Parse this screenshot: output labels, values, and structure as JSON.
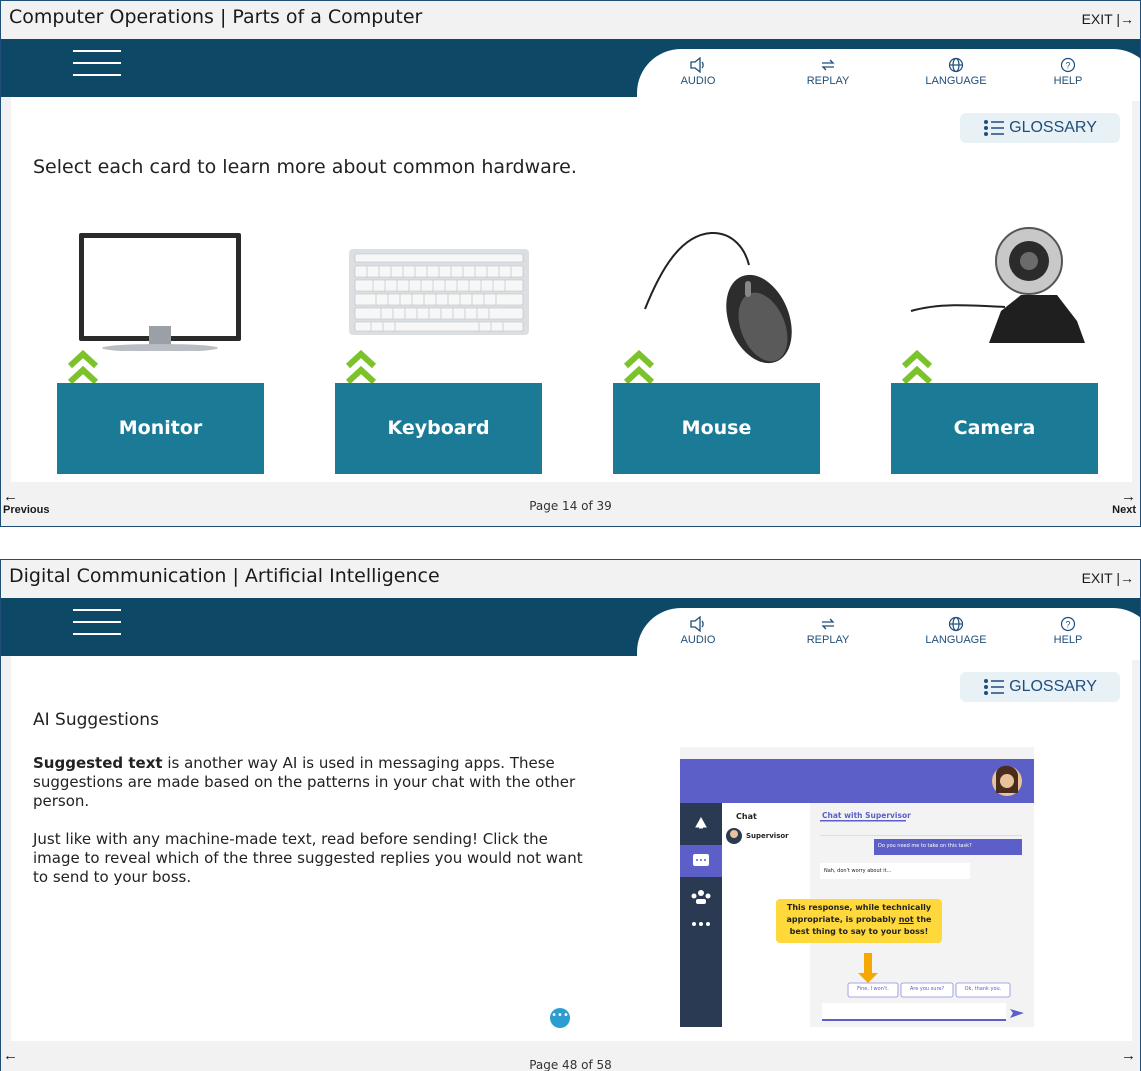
{
  "colors": {
    "navbar": "#0d4867",
    "card": "#1b7b97",
    "chevron": "#7cc22b",
    "accent": "#1f4e79"
  },
  "toolbar": {
    "audio": "AUDIO",
    "replay": "REPLAY",
    "language": "LANGUAGE",
    "help": "HELP",
    "glossary": "GLOSSARY"
  },
  "panel1": {
    "title": "Computer Operations | Parts of a Computer",
    "exit": "EXIT",
    "instruction": "Select each card to learn more about common hardware.",
    "cards": [
      {
        "label": "Monitor",
        "icon": "monitor-image"
      },
      {
        "label": "Keyboard",
        "icon": "keyboard-image"
      },
      {
        "label": "Mouse",
        "icon": "mouse-image"
      },
      {
        "label": "Camera",
        "icon": "webcam-image"
      }
    ],
    "previous": "Previous",
    "next": "Next",
    "page": "Page 14 of 39"
  },
  "panel2": {
    "title": "Digital Communication | Artificial Intelligence",
    "exit": "EXIT",
    "heading": "AI Suggestions",
    "para1_bold": "Suggested text",
    "para1_rest": " is another way AI is used in messaging apps. These suggestions are made based on the patterns in your chat with the other person.",
    "para2": "Just like with any machine-made text, read before sending! Click the image to reveal which of the three suggested replies you would not want to send to your boss.",
    "page": "Page 48 of 58",
    "chat_image": {
      "sidebar_title": "Chat",
      "contact": "Supervisor",
      "tab": "Chat with Supervisor",
      "incoming": "Do you need me to take on this task?",
      "outgoing": "Nah, don't worry about it...",
      "callout_line1": "This response, while technically",
      "callout_line2_a": "appropriate, is probably ",
      "callout_line2_b": "not",
      "callout_line2_c": " the",
      "callout_line3": "best thing to say to your boss!",
      "suggestions": [
        "Fine, I won't.",
        "Are you sure?",
        "Ok, thank you."
      ]
    }
  }
}
